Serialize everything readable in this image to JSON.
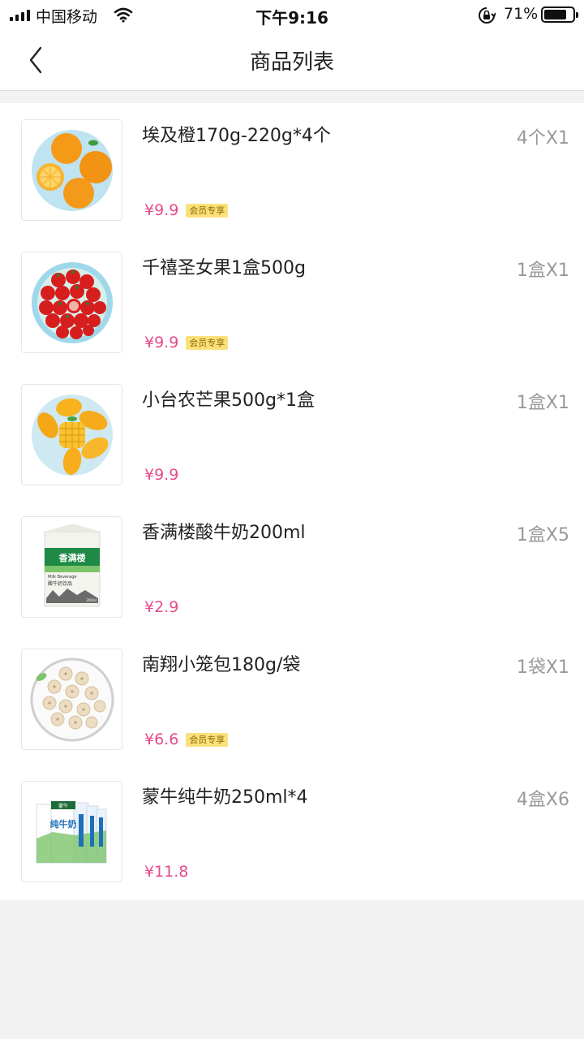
{
  "status_bar": {
    "carrier": "中国移动",
    "time": "下午9:16",
    "battery_text": "71%",
    "battery_level": 0.71
  },
  "nav": {
    "title": "商品列表",
    "back_icon": "chevron-left-icon"
  },
  "products": [
    {
      "name": "埃及橙170g-220g*4个",
      "qty": "4个X1",
      "price": "¥9.9",
      "badge": "会员专享",
      "image": "orange"
    },
    {
      "name": "千禧圣女果1盒500g",
      "qty": "1盒X1",
      "price": "¥9.9",
      "badge": "会员专享",
      "image": "cherry-tomato"
    },
    {
      "name": "小台农芒果500g*1盒",
      "qty": "1盒X1",
      "price": "¥9.9",
      "badge": "",
      "image": "mango"
    },
    {
      "name": "香满楼酸牛奶200ml",
      "qty": "1盒X5",
      "price": "¥2.9",
      "badge": "",
      "image": "yogurt-carton",
      "image_text": {
        "brand": "香满楼",
        "line1": "Milk Beverage",
        "line2": "酸牛奶饮品",
        "volume": "200ml"
      }
    },
    {
      "name": "南翔小笼包180g/袋",
      "qty": "1袋X1",
      "price": "¥6.6",
      "badge": "会员专享",
      "image": "dumplings"
    },
    {
      "name": "蒙牛纯牛奶250ml*4",
      "qty": "4盒X6",
      "price": "¥11.8",
      "badge": "",
      "image": "milk-cartons",
      "image_text": {
        "brand": "蒙牛",
        "label": "纯牛奶"
      }
    }
  ],
  "colors": {
    "price": "#e64a8c",
    "badge_bg": "#fbe17c",
    "qty": "#999999",
    "page_bg": "#f2f2f2"
  }
}
